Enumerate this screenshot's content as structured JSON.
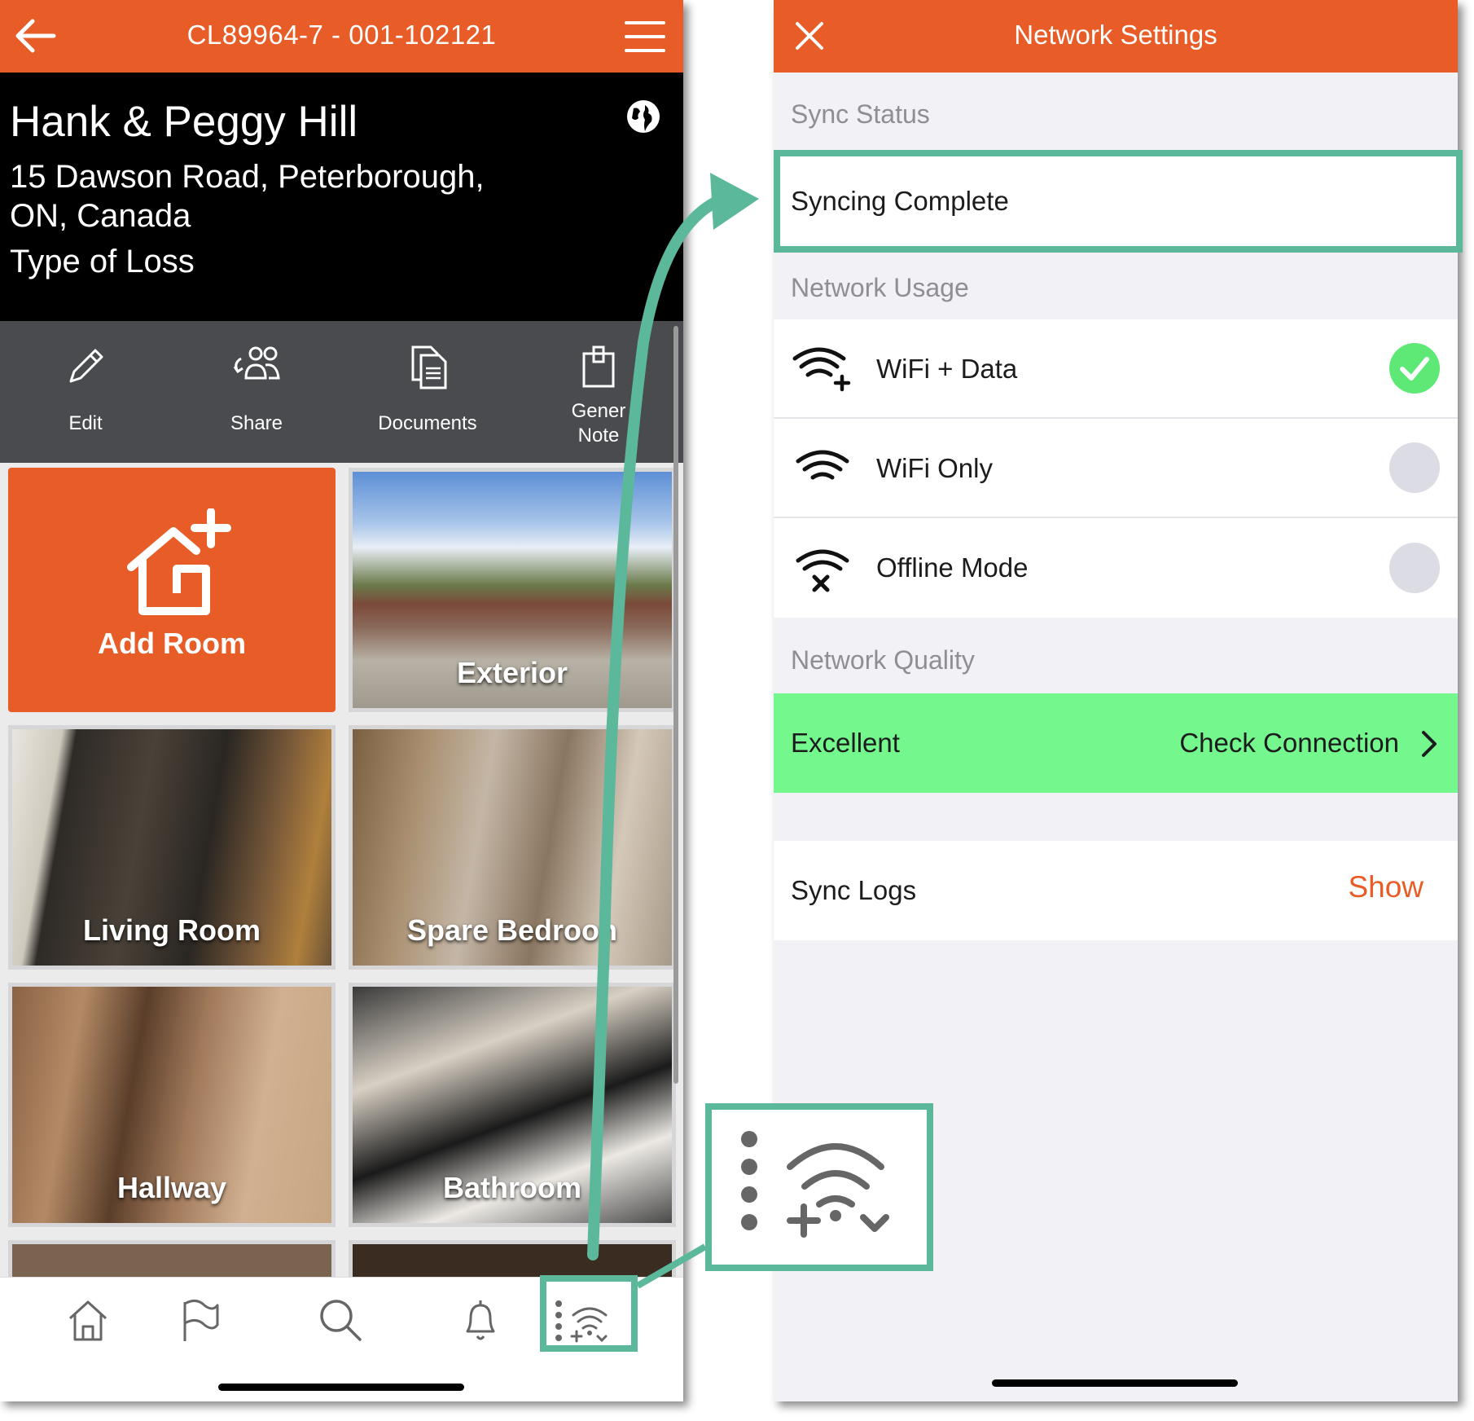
{
  "left": {
    "header": {
      "title": "CL89964-7 - 001-102121"
    },
    "info": {
      "name": "Hank & Peggy Hill",
      "address_line1": "15 Dawson Road, Peterborough,",
      "address_line2": "ON, Canada",
      "type_of_loss": "Type of Loss"
    },
    "actions": [
      {
        "label": "Edit",
        "icon": "pencil-icon"
      },
      {
        "label": "Share",
        "icon": "people-share-icon"
      },
      {
        "label": "Documents",
        "icon": "documents-icon"
      },
      {
        "label_line1": "Gener",
        "label_line2": "Note",
        "icon": "clipboard-icon"
      }
    ],
    "tiles": [
      {
        "label": "Add Room",
        "type": "action"
      },
      {
        "label": "Exterior",
        "type": "photo"
      },
      {
        "label": "Living Room",
        "type": "photo"
      },
      {
        "label": "Spare Bedroon",
        "type": "photo"
      },
      {
        "label": "Hallway",
        "type": "photo"
      },
      {
        "label": "Bathroom",
        "type": "photo"
      }
    ],
    "tabbar": [
      "home-icon",
      "flag-icon",
      "search-icon",
      "bell-icon",
      "network-status-icon"
    ]
  },
  "right": {
    "header": {
      "title": "Network Settings"
    },
    "sync_status": {
      "header": "Sync Status",
      "value": "Syncing Complete"
    },
    "network_usage": {
      "header": "Network Usage",
      "options": [
        {
          "label": "WiFi + Data",
          "selected": true,
          "icon": "wifi-plus-icon"
        },
        {
          "label": "WiFi Only",
          "selected": false,
          "icon": "wifi-icon"
        },
        {
          "label": "Offline Mode",
          "selected": false,
          "icon": "wifi-off-icon"
        }
      ]
    },
    "network_quality": {
      "header": "Network Quality",
      "value": "Excellent",
      "action": "Check Connection"
    },
    "sync_logs": {
      "label": "Sync Logs",
      "action": "Show"
    }
  },
  "colors": {
    "brand": "#e85c27",
    "annotation": "#5bb89b",
    "quality_excellent": "#74f78c",
    "radio_selected": "#5ee876"
  }
}
